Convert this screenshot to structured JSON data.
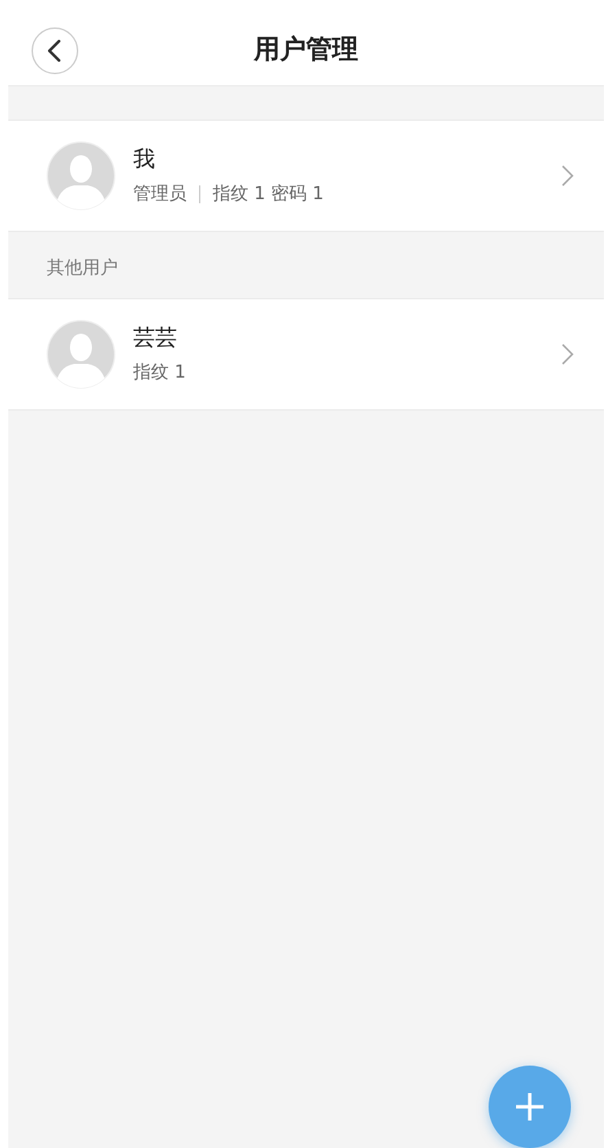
{
  "header": {
    "title": "用户管理"
  },
  "sections": [
    {
      "users": [
        {
          "name": "我",
          "details": [
            "管理员",
            "指纹 1 密码 1"
          ]
        }
      ]
    },
    {
      "heading": "其他用户",
      "users": [
        {
          "name": "芸芸",
          "details": [
            "指纹 1"
          ]
        }
      ]
    }
  ]
}
